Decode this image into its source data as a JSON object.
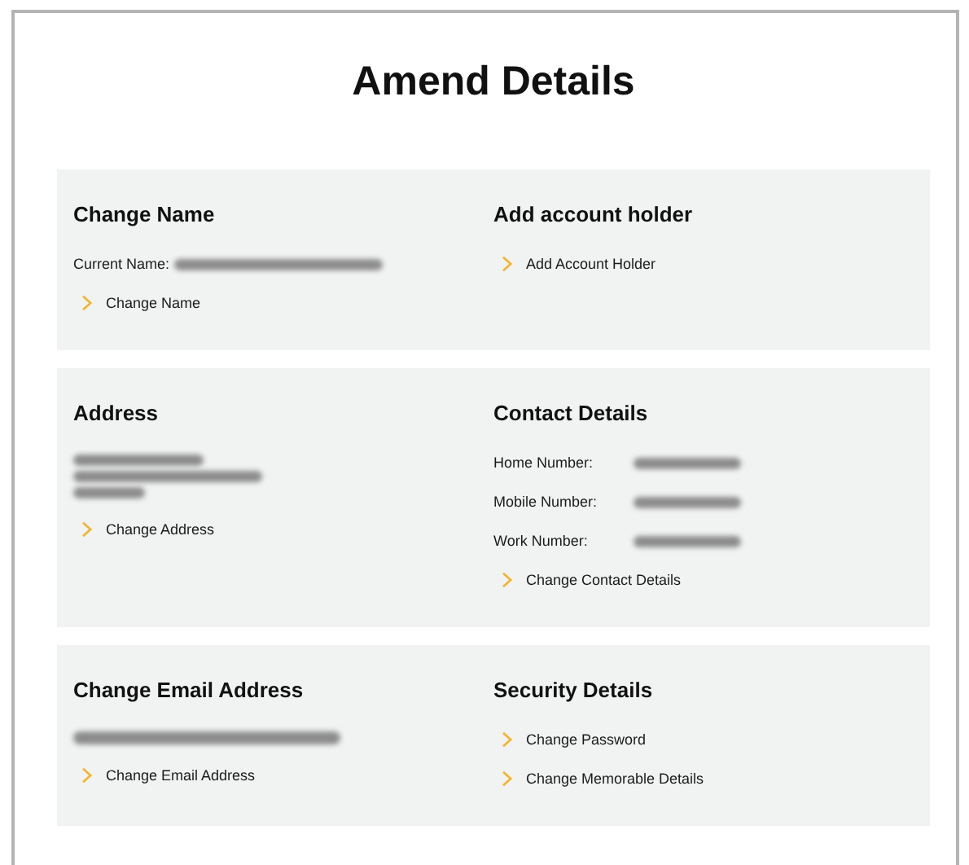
{
  "title": "Amend Details",
  "cards": [
    {
      "columns": [
        {
          "heading": "Change Name",
          "items": [
            {
              "kind": "field",
              "label": "Current Name:",
              "redacted": true
            },
            {
              "kind": "link",
              "label": "Change Name"
            }
          ]
        },
        {
          "heading": "Add account holder",
          "items": [
            {
              "kind": "link",
              "label": "Add Account Holder"
            }
          ]
        }
      ]
    },
    {
      "columns": [
        {
          "heading": "Address",
          "items": [
            {
              "kind": "redacted",
              "lines": [
                {
                  "redacted": true
                },
                {
                  "redacted": true
                },
                {
                  "redacted": true
                }
              ]
            },
            {
              "kind": "link",
              "label": "Change Address"
            }
          ]
        },
        {
          "heading": "Contact Details",
          "items": [
            {
              "kind": "field",
              "label": "Home Number:",
              "redacted": true
            },
            {
              "kind": "field",
              "label": "Mobile Number:",
              "redacted": true
            },
            {
              "kind": "field",
              "label": "Work Number:",
              "redacted": true
            },
            {
              "kind": "link",
              "label": "Change Contact Details"
            }
          ]
        }
      ]
    },
    {
      "columns": [
        {
          "heading": "Change Email Address",
          "items": [
            {
              "kind": "redacted",
              "lines": [
                {
                  "redacted": true
                }
              ]
            },
            {
              "kind": "link",
              "label": "Change Email Address"
            }
          ]
        },
        {
          "heading": "Security Details",
          "items": [
            {
              "kind": "link",
              "label": "Change Password"
            },
            {
              "kind": "link",
              "label": "Change Memorable Details"
            }
          ]
        }
      ]
    }
  ]
}
